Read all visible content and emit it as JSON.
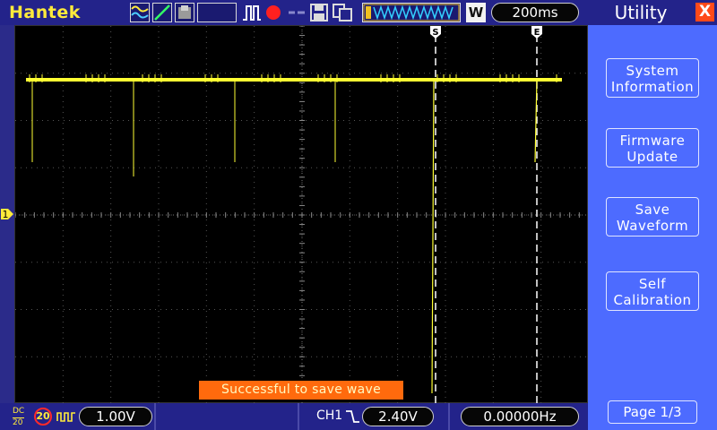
{
  "topbar": {
    "brand": "Hantek",
    "icons": [
      "waveform-mode-icon",
      "slope-icon",
      "persist-icon",
      "pulse-icon",
      "record-icon",
      "cursor-icon",
      "save-icon",
      "storage-icon",
      "memory-waveform-icon"
    ],
    "window_button": "W",
    "timebase": "200ms"
  },
  "screen": {
    "cursor_s_label": "S",
    "cursor_e_label": "E",
    "channel_marker": "1",
    "trace_color": "#ffff33",
    "toast": "Successful to save wave"
  },
  "bottombar": {
    "coupling_top": "DC",
    "coupling_bottom": "20",
    "bandwidth_limit": "20",
    "ch1_scale": "1.00V",
    "trigger_channel": "CH1",
    "trigger_level": "2.40V",
    "frequency": "0.00000Hz"
  },
  "panel": {
    "title": "Utility",
    "close_label": "X",
    "buttons": [
      {
        "line1": "System",
        "line2": "Information"
      },
      {
        "line1": "Firmware",
        "line2": "Update"
      },
      {
        "line1": "Save",
        "line2": "Waveform"
      },
      {
        "line1": "Self",
        "line2": "Calibration"
      }
    ],
    "page": "Page 1/3"
  }
}
